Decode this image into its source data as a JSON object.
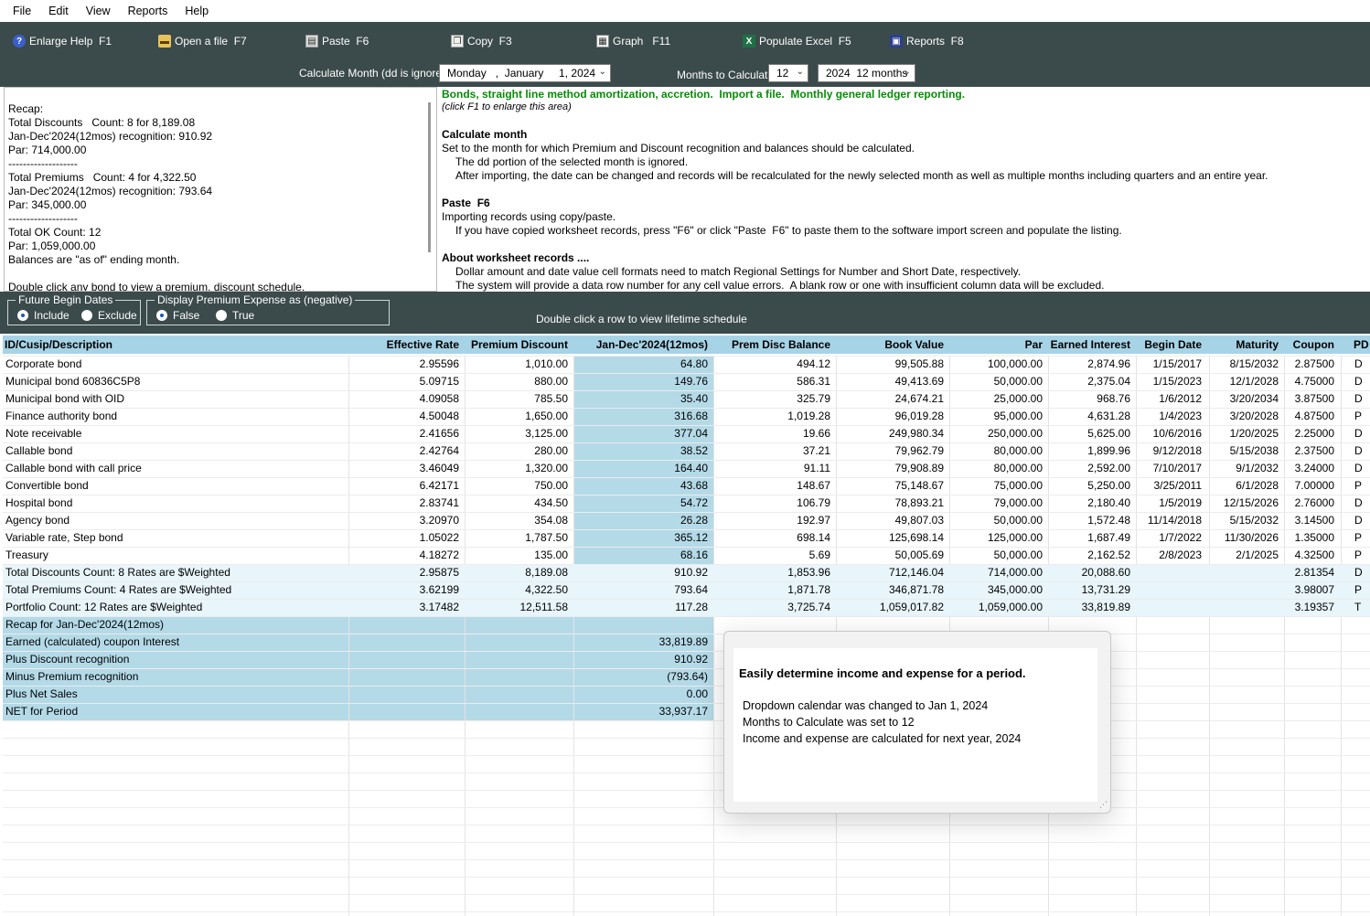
{
  "menu": [
    "File",
    "Edit",
    "View",
    "Reports",
    "Help"
  ],
  "toolbar": [
    {
      "name": "enlarge-help-button",
      "icon": "help-icon",
      "label": "Enlarge Help  F1"
    },
    {
      "name": "open-file-button",
      "icon": "folder-icon",
      "label": "Open a file  F7"
    },
    {
      "name": "paste-button",
      "icon": "clipboard-icon",
      "label": "Paste  F6"
    },
    {
      "name": "copy-button",
      "icon": "copy-icon",
      "label": "Copy  F3"
    },
    {
      "name": "graph-button",
      "icon": "graph-icon",
      "label": "Graph   F11"
    },
    {
      "name": "populate-excel-button",
      "icon": "excel-icon",
      "label": "Populate Excel  F5"
    },
    {
      "name": "reports-button",
      "icon": "report-icon",
      "label": "Reports  F8"
    }
  ],
  "calc": {
    "label": "Calculate Month (dd is ignored)",
    "date_value": "Monday   ,  January     1, 2024",
    "months_label": "Months to Calculate",
    "months_value": "12",
    "period_value": "2024  12 months"
  },
  "recap_lines": [
    "Recap:",
    "Total Discounts   Count: 8 for 8,189.08",
    "Jan-Dec'2024(12mos) recognition: 910.92",
    "Par: 714,000.00",
    "-------------------",
    "Total Premiums   Count: 4 for 4,322.50",
    "Jan-Dec'2024(12mos) recognition: 793.64",
    "Par: 345,000.00",
    "-------------------",
    "Total OK Count: 12",
    "Par: 1,059,000.00",
    "Balances are \"as of\" ending month.",
    "",
    "Double click any bond to view a premium, discount schedule."
  ],
  "help": {
    "title": "Bonds, straight line method amortization, accretion.  Import a file.  Monthly general ledger reporting.",
    "subtitle": "(click F1 to enlarge this area)",
    "calc_heading": "Calculate month",
    "calc_line1": "Set to the month for which Premium and Discount recognition and balances should be calculated.",
    "calc_line2": "The dd portion of the selected month is ignored.",
    "calc_line3": "After importing, the date can be changed and records will be recalculated for the newly selected month as well as multiple months including quarters and an entire year.",
    "paste_heading": "Paste  F6",
    "paste_line1": "Importing records using copy/paste.",
    "paste_line2": "If you have copied worksheet records, press \"F6\" or click \"Paste  F6\" to paste them to the software import screen and populate the listing.",
    "about_heading": "About worksheet records ....",
    "about_line1": "Dollar amount and date value cell formats need to match Regional Settings for Number and Short Date, respectively.",
    "about_line2": "The system will provide a data row number for any cell value errors.  A blank row or one with insufficient column data will be excluded."
  },
  "options": {
    "future_title": "Future Begin Dates",
    "future_include": "Include",
    "future_exclude": "Exclude",
    "premium_title": "Display Premium Expense as (negative)",
    "premium_false": "False",
    "premium_true": "True",
    "hint": "Double click a row to view lifetime schedule"
  },
  "columns": [
    "ID/Cusip/Description",
    "Effective Rate",
    "Premium Discount",
    "Jan-Dec'2024(12mos)",
    "Prem Disc Balance",
    "Book Value",
    "Par",
    "Earned Interest",
    "Begin Date",
    "Maturity",
    "Coupon",
    "PD"
  ],
  "rows": [
    [
      "Corporate bond",
      "2.95596",
      "1,010.00",
      "64.80",
      "494.12",
      "99,505.88",
      "100,000.00",
      "2,874.96",
      "1/15/2017",
      "8/15/2032",
      "2.87500",
      "D"
    ],
    [
      "Municipal bond  60836C5P8",
      "5.09715",
      "880.00",
      "149.76",
      "586.31",
      "49,413.69",
      "50,000.00",
      "2,375.04",
      "1/15/2023",
      "12/1/2028",
      "4.75000",
      "D"
    ],
    [
      "Municipal bond with OID",
      "4.09058",
      "785.50",
      "35.40",
      "325.79",
      "24,674.21",
      "25,000.00",
      "968.76",
      "1/6/2012",
      "3/20/2034",
      "3.87500",
      "D"
    ],
    [
      "Finance authority bond",
      "4.50048",
      "1,650.00",
      "316.68",
      "1,019.28",
      "96,019.28",
      "95,000.00",
      "4,631.28",
      "1/4/2023",
      "3/20/2028",
      "4.87500",
      "P"
    ],
    [
      "Note receivable",
      "2.41656",
      "3,125.00",
      "377.04",
      "19.66",
      "249,980.34",
      "250,000.00",
      "5,625.00",
      "10/6/2016",
      "1/20/2025",
      "2.25000",
      "D"
    ],
    [
      "Callable bond",
      "2.42764",
      "280.00",
      "38.52",
      "37.21",
      "79,962.79",
      "80,000.00",
      "1,899.96",
      "9/12/2018",
      "5/15/2038",
      "2.37500",
      "D"
    ],
    [
      "Callable bond with call price",
      "3.46049",
      "1,320.00",
      "164.40",
      "91.11",
      "79,908.89",
      "80,000.00",
      "2,592.00",
      "7/10/2017",
      "9/1/2032",
      "3.24000",
      "D"
    ],
    [
      "Convertible bond",
      "6.42171",
      "750.00",
      "43.68",
      "148.67",
      "75,148.67",
      "75,000.00",
      "5,250.00",
      "3/25/2011",
      "6/1/2028",
      "7.00000",
      "P"
    ],
    [
      "Hospital bond",
      "2.83741",
      "434.50",
      "54.72",
      "106.79",
      "78,893.21",
      "79,000.00",
      "2,180.40",
      "1/5/2019",
      "12/15/2026",
      "2.76000",
      "D"
    ],
    [
      "Agency bond",
      "3.20970",
      "354.08",
      "26.28",
      "192.97",
      "49,807.03",
      "50,000.00",
      "1,572.48",
      "11/14/2018",
      "5/15/2032",
      "3.14500",
      "D"
    ],
    [
      "Variable rate, Step bond",
      "1.05022",
      "1,787.50",
      "365.12",
      "698.14",
      "125,698.14",
      "125,000.00",
      "1,687.49",
      "1/7/2022",
      "11/30/2026",
      "1.35000",
      "P"
    ],
    [
      "Treasury",
      "4.18272",
      "135.00",
      "68.16",
      "5.69",
      "50,005.69",
      "50,000.00",
      "2,162.52",
      "2/8/2023",
      "2/1/2025",
      "4.32500",
      "P"
    ]
  ],
  "totals": [
    [
      "Total Discounts   Count: 8    Rates are $Weighted",
      "2.95875",
      "8,189.08",
      "910.92",
      "1,853.96",
      "712,146.04",
      "714,000.00",
      "20,088.60",
      "",
      "",
      "2.81354",
      "D"
    ],
    [
      "Total Premiums   Count: 4    Rates are $Weighted",
      "3.62199",
      "4,322.50",
      "793.64",
      "1,871.78",
      "346,871.78",
      "345,000.00",
      "13,731.29",
      "",
      "",
      "3.98007",
      "P"
    ],
    [
      "Portfolio   Count: 12    Rates are $Weighted",
      "3.17482",
      "12,511.58",
      "117.28",
      "3,725.74",
      "1,059,017.82",
      "1,059,000.00",
      "33,819.89",
      "",
      "",
      "3.19357",
      "T"
    ]
  ],
  "recap_rows": [
    [
      "Recap for Jan-Dec'2024(12mos)",
      ""
    ],
    [
      "Earned (calculated) coupon Interest",
      "33,819.89"
    ],
    [
      "Plus Discount recognition",
      "910.92"
    ],
    [
      "Minus Premium recognition",
      "(793.64)"
    ],
    [
      "Plus Net Sales",
      "0.00"
    ],
    [
      "NET for Period",
      "33,937.17"
    ]
  ],
  "popup": {
    "title": "Easily determine income and expense for a period.",
    "line1": "Dropdown calendar was changed to Jan 1, 2024",
    "line2": "Months to Calculate was set to 12",
    "line3": "Income and expense are calculated for next year, 2024"
  },
  "colors": {
    "panel": "#3b4a4a",
    "header": "#a7d3e6",
    "highlight_column": "#b4dae8",
    "totals_row": "#e8f5fa",
    "recap_row": "#b4dae8",
    "help_green": "#0a8a0a"
  }
}
